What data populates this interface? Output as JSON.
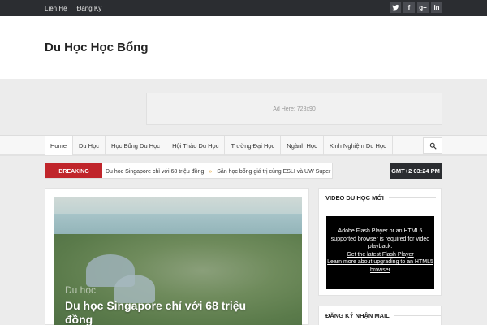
{
  "topbar": {
    "links": [
      "Liên Hệ",
      "Đăng Ký"
    ],
    "social": [
      "twitter-icon",
      "facebook-icon",
      "google-plus-icon",
      "linkedin-icon"
    ]
  },
  "header": {
    "site_title": "Du Học Học Bổng"
  },
  "ad": {
    "text": "Ad Here: 728x90"
  },
  "nav": {
    "items": [
      "Home",
      "Du Học",
      "Học Bổng Du Học",
      "Hội Thảo Du Học",
      "Trường Đại Học",
      "Ngành Học",
      "Kinh Nghiệm Du Học"
    ]
  },
  "breaking": {
    "label": "BREAKING",
    "items": [
      "Du học Singapore chỉ với 68 triệu đồng",
      "Săn học bổng giá trị cùng ESLI và UW Super"
    ]
  },
  "clock": {
    "text": "GMT+2 03:24 PM"
  },
  "featured": {
    "category": "Du học",
    "title": "Du học Singapore chỉ với 68 triệu đồng"
  },
  "sidebar": {
    "video_title": "VIDEO DU HỌC MỚI",
    "flash_line1": "Adobe Flash Player or an HTML5 supported browser is required for video playback.",
    "flash_link1": "Get the latest Flash Player",
    "flash_link2": "Learn more about upgrading to an HTML5 browser",
    "newsletter_title": "ĐĂNG KÝ NHẬN MAIL"
  },
  "colors": {
    "breaking_red": "#c0252b",
    "dark": "#2b2d31",
    "ticker_separator": "#e4a12b"
  }
}
